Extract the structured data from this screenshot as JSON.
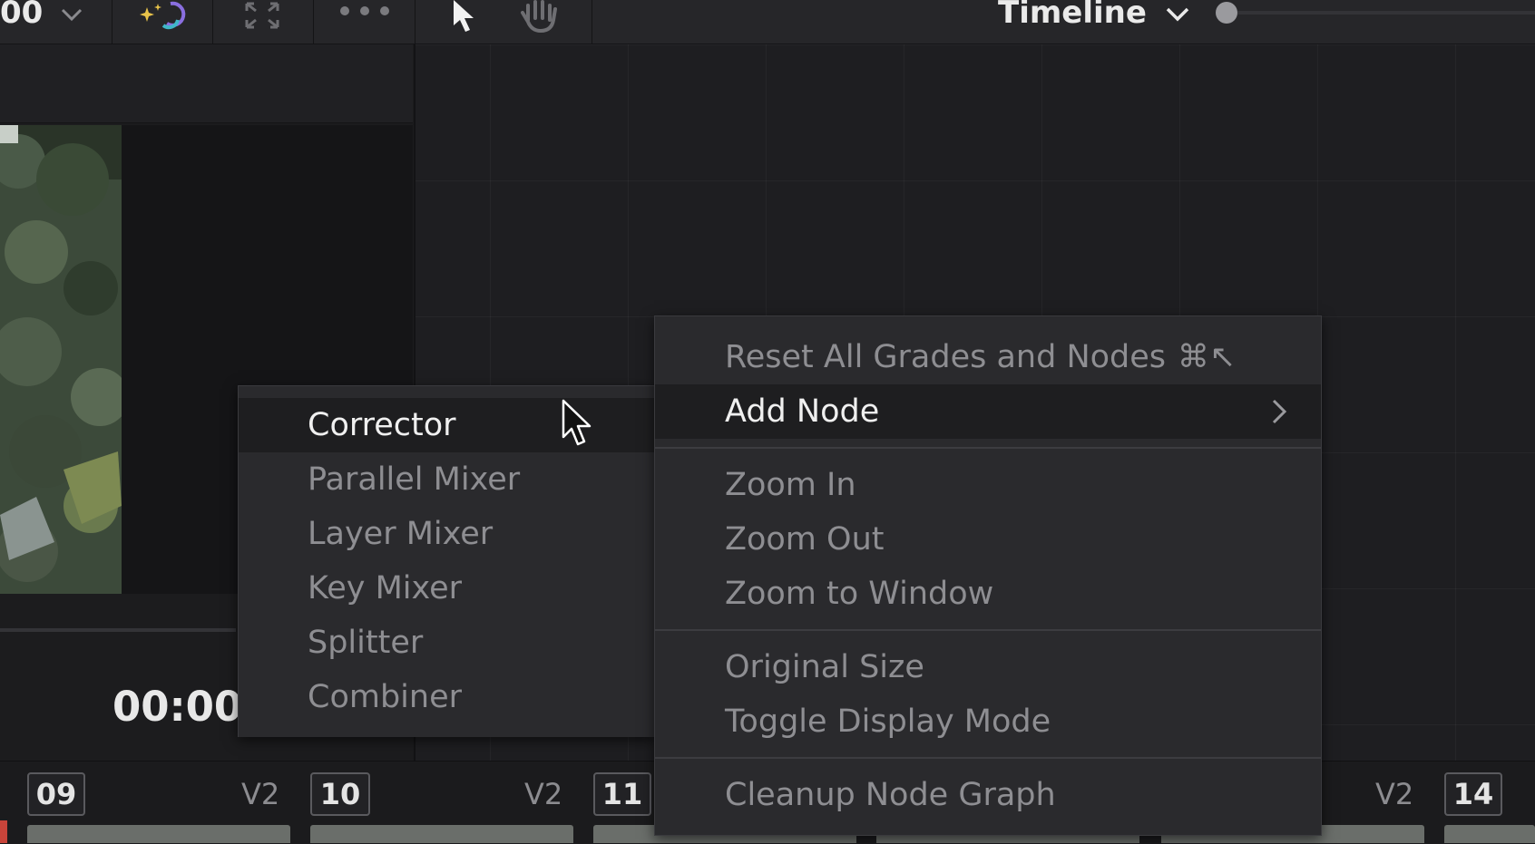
{
  "toolbar": {
    "partial_value": "00",
    "timeline_label": "Timeline"
  },
  "viewer": {
    "timecode": "00:00:"
  },
  "submenu": {
    "items": [
      "Corrector",
      "Parallel Mixer",
      "Layer Mixer",
      "Key Mixer",
      "Splitter",
      "Combiner"
    ]
  },
  "menu": {
    "reset": "Reset All Grades and Nodes",
    "reset_shortcut": "⌘↖",
    "add_node": "Add Node",
    "zoom_in": "Zoom In",
    "zoom_out": "Zoom Out",
    "zoom_window": "Zoom to Window",
    "original_size": "Original Size",
    "toggle_display": "Toggle Display Mode",
    "cleanup": "Cleanup Node Graph"
  },
  "clips": [
    {
      "num": "09",
      "track": "V2"
    },
    {
      "num": "10",
      "track": "V2"
    },
    {
      "num": "11",
      "track": ""
    },
    {
      "num": "14",
      "track": "V2"
    }
  ],
  "colors": {
    "menu_bg": "#2a2a2d",
    "active_text": "#f0f0f0",
    "inactive_text": "#8e8e92"
  }
}
